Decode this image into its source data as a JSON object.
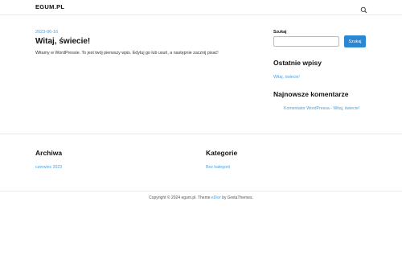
{
  "header": {
    "site_title": "EGUM.PL",
    "search_icon": "search-icon"
  },
  "post": {
    "date": "2023-06-16",
    "title": "Witaj, świecie!",
    "excerpt": "Witamy w WordPressie. To jest twój pierwszy wpis. Edytuj go lub usuń, a następnie zacznij pisać!"
  },
  "sidebar": {
    "search_label": "Szukaj",
    "search_value": "",
    "search_button": "Szukaj",
    "recent_heading": "Ostatnie wpisy",
    "recent_posts": [
      "Witaj, świecie!"
    ],
    "comments_heading": "Najnowsze komentarze",
    "comment": {
      "author": "Komentator WordPressa",
      "separator": " - ",
      "post": "Witaj, świecie!"
    }
  },
  "footer_widgets": {
    "archives_heading": "Archiwa",
    "archives": [
      "czerwiec 2023"
    ],
    "categories_heading": "Kategorie",
    "categories": [
      "Bez kategorii"
    ]
  },
  "footer": {
    "copyright": "Copyright © 2024 egum.pl. Theme ",
    "theme_link": "eDior",
    "by_text": " by GretaThemes."
  },
  "colors": {
    "accent": "#2b86d4",
    "link": "#4a9fe0",
    "divider": "#ebebeb"
  }
}
